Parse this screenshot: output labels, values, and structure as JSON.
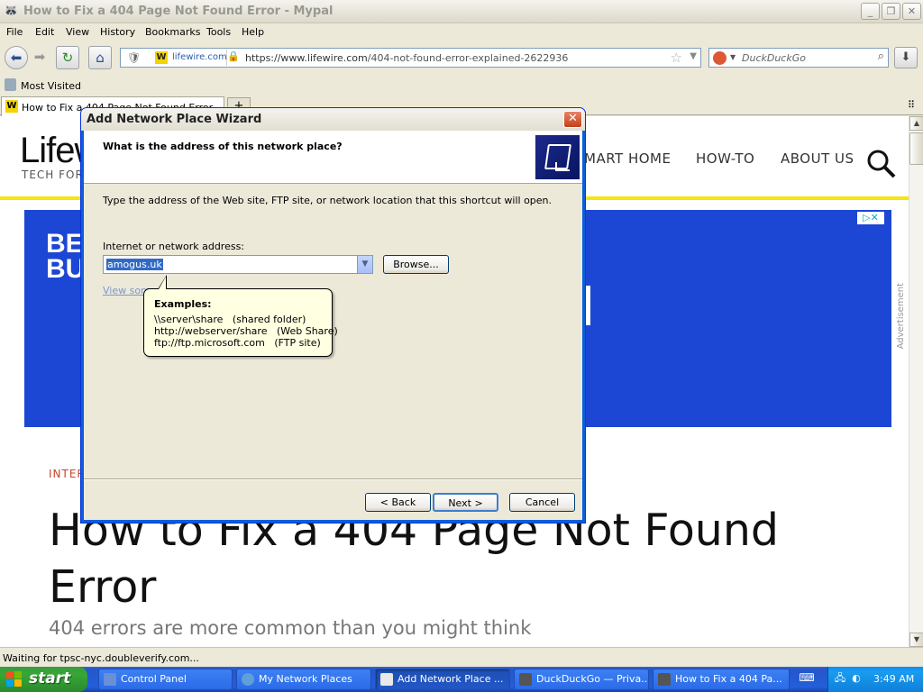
{
  "window": {
    "title": "How to Fix a 404 Page Not Found Error - Mypal",
    "min_glyph": "_",
    "max_glyph": "❐",
    "close_glyph": "✕"
  },
  "menu": [
    "File",
    "Edit",
    "View",
    "History",
    "Bookmarks",
    "Tools",
    "Help"
  ],
  "toolbar": {
    "site_badge": "lifewire.com",
    "url_host": "https://www.lifewire.com",
    "url_path": "/404-not-found-error-explained-2622936",
    "search_placeholder": "DuckDuckGo"
  },
  "bookmarks": {
    "most_visited": "Most Visited"
  },
  "tabs": [
    {
      "label": "How to Fix a 404 Page Not Found Error"
    }
  ],
  "page": {
    "logo": "Lifew",
    "tagline": "TECH FOR",
    "nav": [
      "MART HOME",
      "HOW-TO",
      "ABOUT US"
    ],
    "ad_text_line1": "BE",
    "ad_text_line2": "BU",
    "ad_label": "Advertisement",
    "kicker": "INTER",
    "headline": "How to Fix a 404 Page Not Found Error",
    "subhead": "404 errors are more common than you might think"
  },
  "status": {
    "text": "Waiting for tpsc-nyc.doubleverify.com..."
  },
  "dialog": {
    "title": "Add Network Place Wizard",
    "question": "What is the address of this network place?",
    "description": "Type the address of the Web site, FTP site, or network location that this shortcut will open.",
    "address_label": "Internet or network address:",
    "address_value": "amogus.uk",
    "browse_label": "Browse...",
    "view_link": "View som",
    "tooltip": {
      "title": "Examples:",
      "examples": [
        "\\\\server\\share   (shared folder)",
        "http://webserver/share   (Web Share)",
        "ftp://ftp.microsoft.com   (FTP site)"
      ]
    },
    "back_label": "< Back",
    "next_label": "Next >",
    "cancel_label": "Cancel"
  },
  "taskbar": {
    "start_label": "start",
    "tasks": [
      {
        "label": "Control Panel"
      },
      {
        "label": "My Network Places"
      },
      {
        "label": "Add Network Place ..."
      },
      {
        "label": "DuckDuckGo — Priva..."
      },
      {
        "label": "How to Fix a 404 Pa..."
      }
    ],
    "clock": "3:49 AM"
  }
}
